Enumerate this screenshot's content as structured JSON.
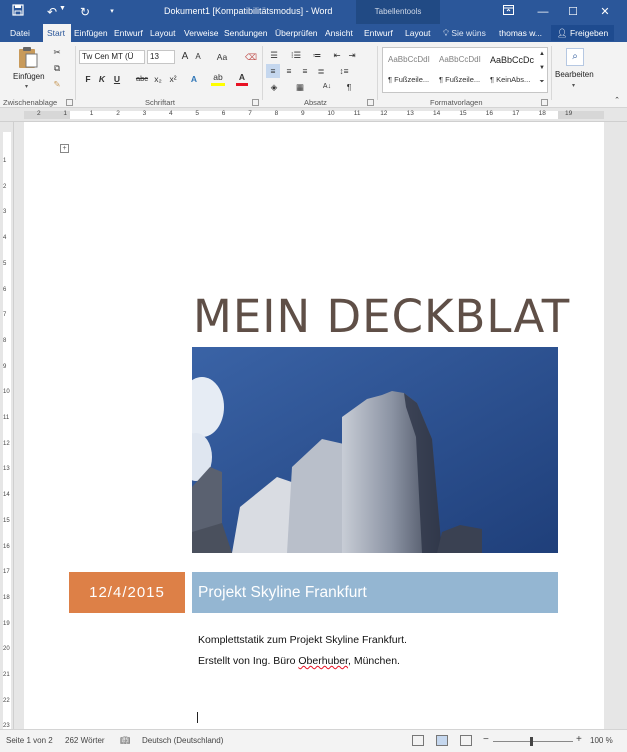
{
  "titlebar": {
    "title": "Dokument1 [Kompatibilitätsmodus] - Word",
    "context_tab": "Tabellentools",
    "icons": [
      "save-icon",
      "undo-icon",
      "redo-icon",
      "ribbon-display-icon",
      "minimize-icon",
      "maximize-icon",
      "close-icon"
    ]
  },
  "tabs": [
    "Datei",
    "Start",
    "Einfügen",
    "Entwurf",
    "Layout",
    "Verweise",
    "Sendungen",
    "Überprüfen",
    "Ansicht",
    "Entwurf",
    "Layout"
  ],
  "active_tab": "Start",
  "tell_me": "Sie wüns",
  "user": "thomas w...",
  "share": "Freigeben",
  "ribbon": {
    "clipboard": {
      "paste": "Einfügen",
      "label": "Zwischenablage"
    },
    "font": {
      "label": "Schriftart",
      "font_name": "Tw Cen MT (Ü",
      "font_size": "13",
      "grow": "A",
      "shrink": "A",
      "case": "Aa",
      "bold": "F",
      "italic": "K",
      "underline": "U",
      "strike": "abc",
      "subscript": "x₂",
      "superscript": "x²",
      "text_effects": "A",
      "highlight": "ab",
      "font_color": "A"
    },
    "paragraph": {
      "label": "Absatz"
    },
    "styles": {
      "label": "Formatvorlagen",
      "items": [
        {
          "preview": "AaBbCcDdI",
          "name": "¶ Fußzeile..."
        },
        {
          "preview": "AaBbCcDdI",
          "name": "¶ Fußzeile..."
        },
        {
          "preview": "AaBbCcDc",
          "name": "¶ KeinAbs..."
        }
      ]
    },
    "editing": {
      "label": "Bearbeiten"
    }
  },
  "ruler_numbers": [
    "2",
    "1",
    "1",
    "2",
    "3",
    "4",
    "5",
    "6",
    "7",
    "8",
    "9",
    "10",
    "11",
    "12",
    "13",
    "14",
    "15",
    "16",
    "17",
    "18",
    "19"
  ],
  "vruler_numbers": [
    "1",
    "2",
    "3",
    "4",
    "5",
    "6",
    "7",
    "8",
    "9",
    "10",
    "11",
    "12",
    "13",
    "14",
    "15",
    "16",
    "17",
    "18",
    "19",
    "20",
    "21",
    "22",
    "23"
  ],
  "document": {
    "title": "MEIN DECKBLAT",
    "date": "12/4/2015",
    "project": "Projekt Skyline Frankfurt",
    "line1": "Komplettstatik zum Projekt Skyline Frankfurt.",
    "line2_prefix": "Erstellt von Ing. Büro ",
    "line2_flag": "Oberhuber",
    "line2_suffix": ", München."
  },
  "status": {
    "page": "Seite 1 von 2",
    "words": "262 Wörter",
    "language": "Deutsch (Deutschland)",
    "zoom": "100 %",
    "zoom_minus": "−",
    "zoom_plus": "+"
  },
  "colors": {
    "word_blue": "#2b579a",
    "title_brown": "#5f4f47",
    "date_orange": "#dd8047",
    "project_blue": "#94b6d2"
  }
}
